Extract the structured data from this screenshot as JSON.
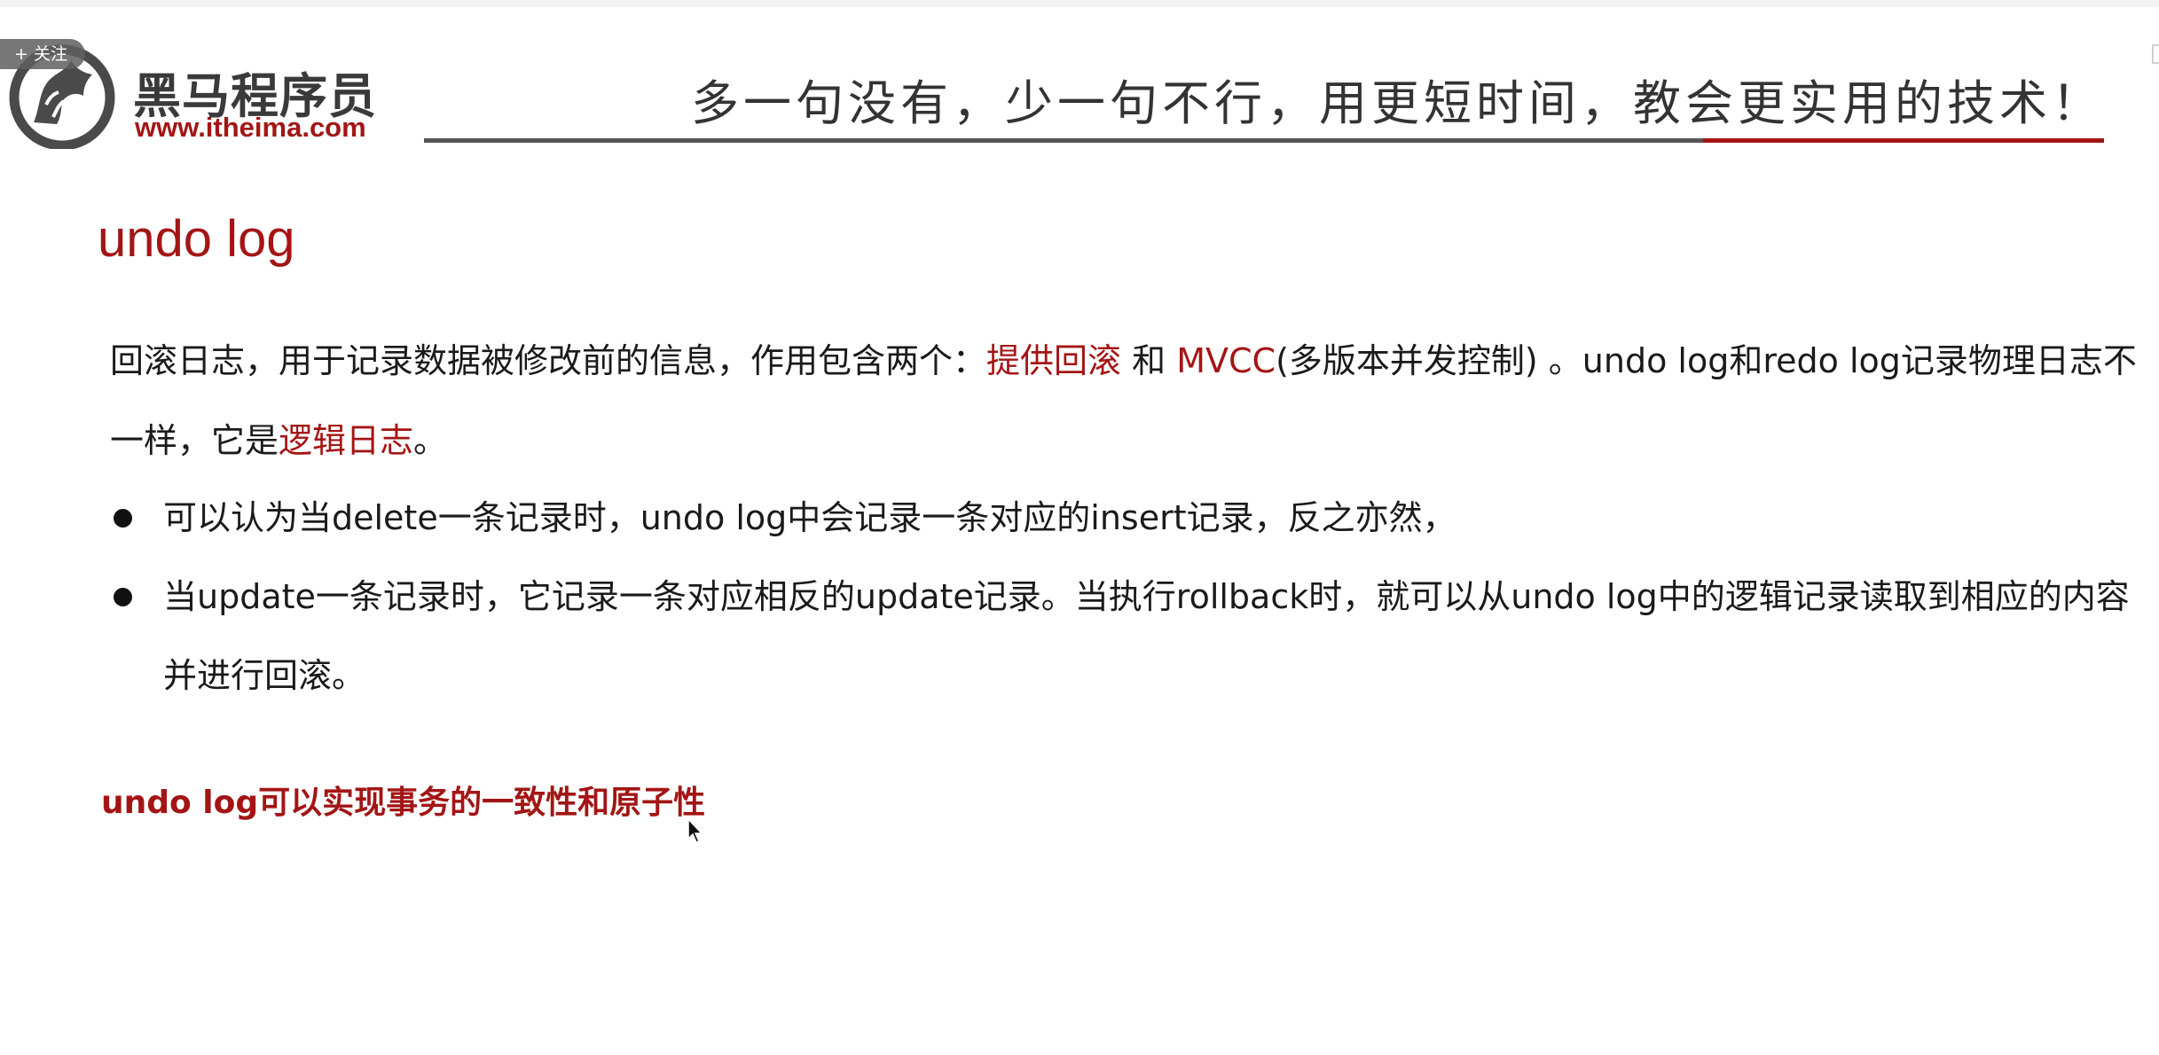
{
  "overlay": {
    "follow_label": "+ 关注"
  },
  "header": {
    "logo_cn": "黑马程序员",
    "logo_url": "www.itheima.com",
    "slogan": "多一句没有，少一句不行，用更短时间，教会更实用的技术！",
    "accent_color": "#a31515",
    "rule_color": "#555555"
  },
  "slide": {
    "title": "undo log",
    "intro": {
      "p1": "回滚日志，用于记录数据被修改前的信息，作用包含两个：",
      "h1": "提供回滚",
      "p2": " 和 ",
      "h2": "MVCC",
      "p3": "(多版本并发控制) 。undo log和redo log记录物理日志不",
      "p4": "一样，它是",
      "h3": "逻辑日志",
      "p5": "。"
    },
    "bullets": [
      {
        "line1": "可以认为当delete一条记录时，undo log中会记录一条对应的insert记录，反之亦然，",
        "line2": ""
      },
      {
        "line1": "当update一条记录时，它记录一条对应相反的update记录。当执行rollback时，就可以从undo log中的逻辑记录读取到相应的内容",
        "line2": "并进行回滚。"
      }
    ],
    "conclusion": "undo log可以实现事务的一致性和原子性"
  },
  "icons": {
    "logo": "horse-logo-icon",
    "cursor": "mouse-pointer-icon",
    "bullet": "bullet-dot-icon"
  }
}
